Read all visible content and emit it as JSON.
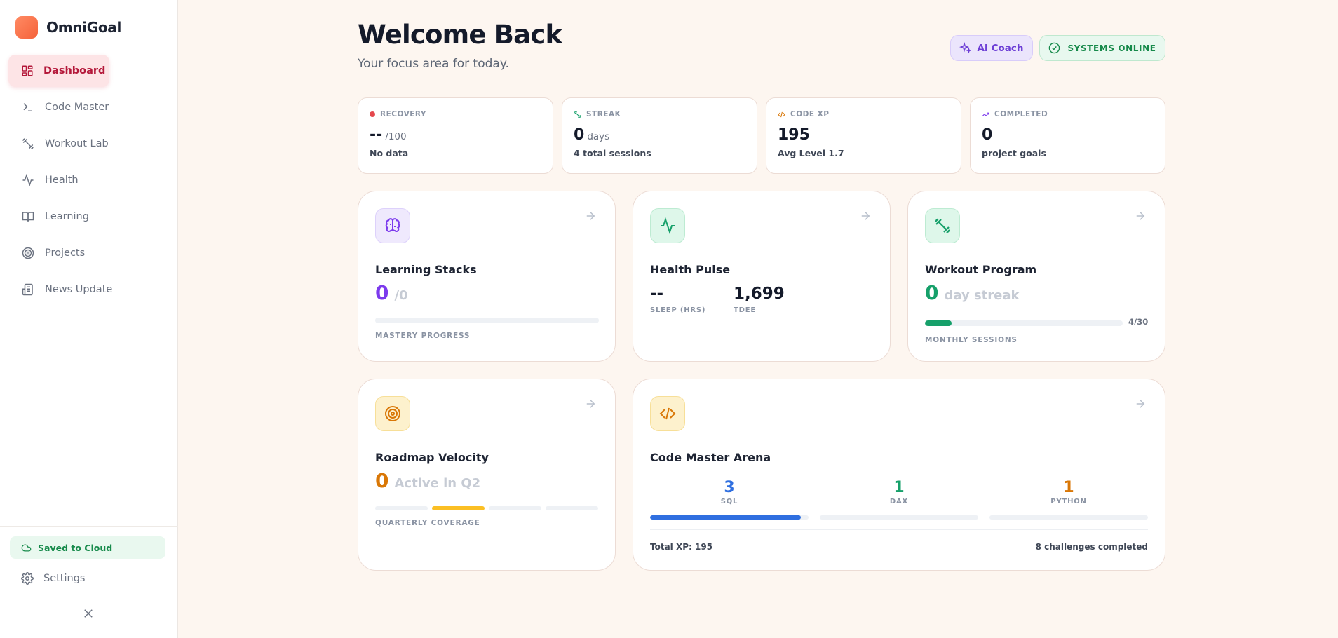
{
  "app": {
    "name": "OmniGoal"
  },
  "sidebar": {
    "items": [
      {
        "label": "Dashboard",
        "icon": "dashboard-icon",
        "active": true
      },
      {
        "label": "Code Master",
        "icon": "terminal-icon"
      },
      {
        "label": "Workout Lab",
        "icon": "dumbbell-icon"
      },
      {
        "label": "Health",
        "icon": "activity-icon"
      },
      {
        "label": "Learning",
        "icon": "book-icon"
      },
      {
        "label": "Projects",
        "icon": "target-icon"
      },
      {
        "label": "News Update",
        "icon": "newspaper-icon"
      }
    ],
    "saved_label": "Saved to Cloud",
    "settings_label": "Settings"
  },
  "header": {
    "title": "Welcome Back",
    "subtitle": "Your focus area for today.",
    "coach_label": "AI Coach",
    "status_label": "SYSTEMS ONLINE"
  },
  "stats": [
    {
      "label": "RECOVERY",
      "value": "--",
      "unit": "/100",
      "sub": "No data"
    },
    {
      "label": "STREAK",
      "value": "0",
      "unit": "days",
      "sub": "4 total sessions"
    },
    {
      "label": "CODE XP",
      "value": "195",
      "unit": "",
      "sub": "Avg Level 1.7"
    },
    {
      "label": "COMPLETED",
      "value": "0",
      "unit": "",
      "sub": "project goals"
    }
  ],
  "cards": {
    "learning": {
      "title": "Learning Stacks",
      "value": "0",
      "unit": "/0",
      "caption": "MASTERY PROGRESS",
      "progress": 0
    },
    "health": {
      "title": "Health Pulse",
      "sleep_value": "--",
      "sleep_label": "SLEEP (HRS)",
      "tdee_value": "1,699",
      "tdee_label": "TDEE"
    },
    "workout": {
      "title": "Workout Program",
      "value": "0",
      "unit": "day streak",
      "progress_text": "4/30",
      "caption": "MONTHLY SESSIONS",
      "progress": 0.133
    },
    "roadmap": {
      "title": "Roadmap Velocity",
      "value": "0",
      "unit": "Active in Q2",
      "caption": "QUARTERLY COVERAGE",
      "active_quarter": 2
    },
    "arena": {
      "title": "Code Master Arena",
      "stats": [
        {
          "value": "3",
          "label": "SQL",
          "color": "#2f6fe0",
          "progress": 0.95
        },
        {
          "value": "1",
          "label": "DAX",
          "color": "#16a06a",
          "progress": 0
        },
        {
          "value": "1",
          "label": "PYTHON",
          "color": "#d97706",
          "progress": 0
        }
      ],
      "total_xp": "Total XP: 195",
      "challenges": "8 challenges completed"
    }
  },
  "colors": {
    "accent_active": "#b4183a",
    "learning": "#7c3aed",
    "workout": "#16a06a",
    "roadmap": "#d97706",
    "roadmap_segment": "#fbbf24"
  }
}
